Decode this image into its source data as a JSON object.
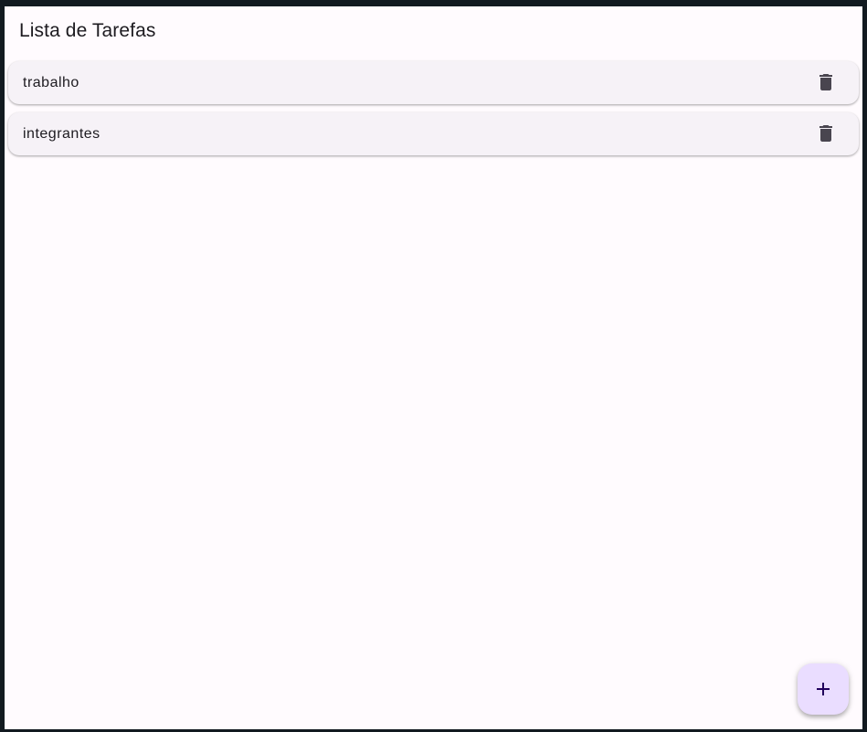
{
  "app": {
    "title": "Lista de Tarefas",
    "accent_color": "#eaddff",
    "surface_color": "#fffbfe",
    "card_color": "#f6f2f7",
    "icon_color": "#49454f"
  },
  "tasks": [
    {
      "label": "trabalho",
      "action_icon": "trash-icon"
    },
    {
      "label": "integrantes",
      "action_icon": "trash-icon"
    }
  ],
  "fab": {
    "icon": "plus-icon"
  }
}
